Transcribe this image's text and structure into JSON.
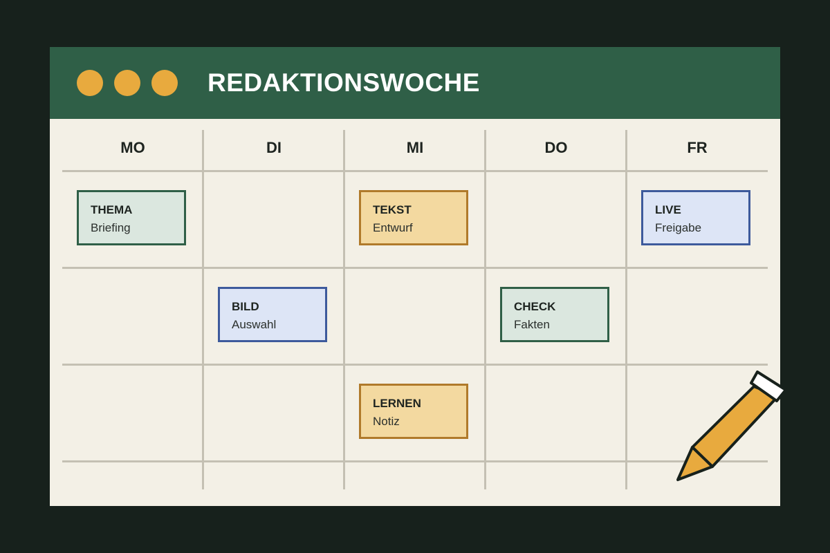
{
  "window": {
    "title": "REDAKTIONSWOCHE",
    "controls": [
      "window-dot-1",
      "window-dot-2",
      "window-dot-3"
    ]
  },
  "days": [
    "MO",
    "DI",
    "MI",
    "DO",
    "FR"
  ],
  "cards": [
    {
      "day": "MO",
      "row": 1,
      "title": "THEMA",
      "subtitle": "Briefing",
      "color": "green"
    },
    {
      "day": "MI",
      "row": 1,
      "title": "TEKST",
      "subtitle": "Entwurf",
      "color": "yellow"
    },
    {
      "day": "FR",
      "row": 1,
      "title": "LIVE",
      "subtitle": "Freigabe",
      "color": "blue"
    },
    {
      "day": "DI",
      "row": 2,
      "title": "BILD",
      "subtitle": "Auswahl",
      "color": "blue"
    },
    {
      "day": "DO",
      "row": 2,
      "title": "CHECK",
      "subtitle": "Fakten",
      "color": "green"
    },
    {
      "day": "MI",
      "row": 3,
      "title": "LERNEN",
      "subtitle": "Notiz",
      "color": "yellow"
    }
  ],
  "colors": {
    "accent_green": "#2f5f47",
    "accent_yellow": "#e8aa3e",
    "accent_blue": "#3d5a9c",
    "background": "#17211c",
    "paper": "#f3f0e6"
  },
  "icons": {
    "pencil": "pencil-icon",
    "window_dot": "circle-icon"
  }
}
